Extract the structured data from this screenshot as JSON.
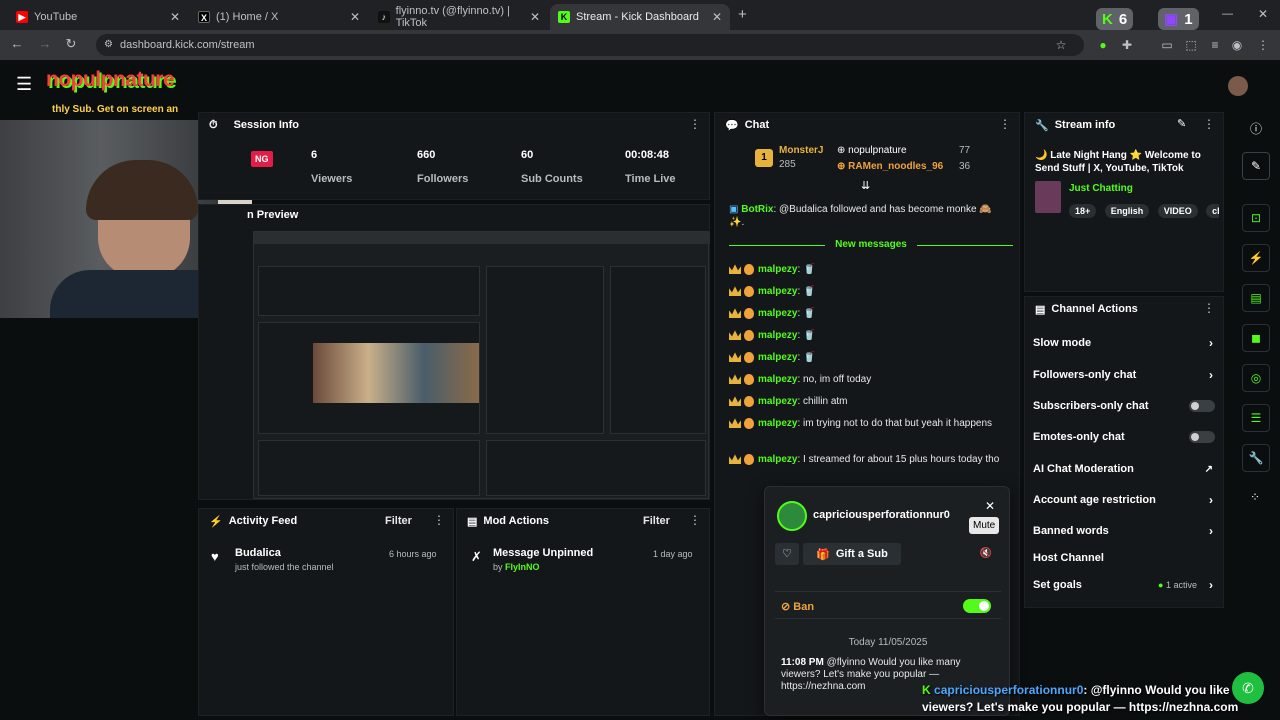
{
  "browser": {
    "tabs": [
      {
        "title": "YouTube",
        "color": "#ff0000",
        "glyph": "▶"
      },
      {
        "title": "(1) Home / X",
        "color": "#000000",
        "glyph": "X"
      },
      {
        "title": "flyinno.tv (@flyinno.tv) | TikTok",
        "color": "#111111",
        "glyph": "♪"
      },
      {
        "title": "Stream - Kick Dashboard",
        "color": "#53fc18",
        "glyph": "K"
      }
    ],
    "url": "dashboard.kick.com/stream",
    "ext_kick_count": "6",
    "ext_twitch_count": "1"
  },
  "header": {
    "logo_text": "nopulpnature",
    "overlay_line": "thly Sub. Get on screen an"
  },
  "session": {
    "title": "Session Info",
    "live_badge": "NG",
    "stats": [
      {
        "value": "6",
        "label": "Viewers"
      },
      {
        "value": "660",
        "label": "Followers"
      },
      {
        "value": "60",
        "label": "Sub Counts"
      },
      {
        "value": "00:08:48",
        "label": "Time Live"
      }
    ],
    "preview_title": "n Preview"
  },
  "chat": {
    "title": "Chat",
    "leaderboard": {
      "rank": "1",
      "top_name": "MonsterJ",
      "top_count": "285",
      "others": [
        {
          "name": "nopulpnature",
          "count": "77"
        },
        {
          "name": "RAMen_noodles_96",
          "count": "36"
        }
      ]
    },
    "botrix_user": "BotRix",
    "botrix_msg": ": @Budalica followed and has become monke 🙈 ✨.",
    "new_messages": "New messages",
    "messages": [
      {
        "user": "malpezy",
        "text": ": 🥤"
      },
      {
        "user": "malpezy",
        "text": ": 🥤"
      },
      {
        "user": "malpezy",
        "text": ": 🥤"
      },
      {
        "user": "malpezy",
        "text": ": 🥤"
      },
      {
        "user": "malpezy",
        "text": ": 🥤"
      },
      {
        "user": "malpezy",
        "text": ": no, im off today"
      },
      {
        "user": "malpezy",
        "text": ": chillin atm"
      },
      {
        "user": "malpezy",
        "text": ": im trying not to do that but yeah it happens"
      },
      {
        "user": "malpezy",
        "text": ": I streamed for about 15 plus hours today tho"
      }
    ]
  },
  "popup": {
    "username": "capriciousperforationnur0",
    "mute_tooltip": "Mute",
    "gift_label": "Gift a Sub",
    "ban_label": "Ban",
    "date": "Today 11/05/2025",
    "time": "11:08 PM",
    "message": "@flyinno Would you like many viewers? Let's make you popular — https://nezhna.com"
  },
  "stream_info": {
    "title": "Stream info",
    "stream_title": "🌙 Late Night Hang ⭐ Welcome to Send Stuff | X, YouTube, TikTok",
    "category": "Just Chatting",
    "tags": [
      "18+",
      "English",
      "VIDEO",
      "ch"
    ]
  },
  "channel_actions": {
    "title": "Channel Actions",
    "items": [
      {
        "label": "Slow mode",
        "kind": "chevron"
      },
      {
        "label": "Followers-only chat",
        "kind": "chevron"
      },
      {
        "label": "Subscribers-only chat",
        "kind": "toggle"
      },
      {
        "label": "Emotes-only chat",
        "kind": "toggle"
      },
      {
        "label": "AI Chat Moderation",
        "kind": "link"
      },
      {
        "label": "Account age restriction",
        "kind": "chevron"
      },
      {
        "label": "Banned words",
        "kind": "chevron"
      },
      {
        "label": "Host Channel",
        "kind": "none"
      },
      {
        "label": "Set goals",
        "kind": "chevron",
        "extra": "1 active"
      }
    ]
  },
  "activity": {
    "title": "Activity Feed",
    "filter": "Filter",
    "item_user": "Budalica",
    "item_text": "just followed the channel",
    "item_time": "6 hours ago"
  },
  "mod_actions": {
    "title": "Mod Actions",
    "filter": "Filter",
    "item_action": "Message Unpinned",
    "item_by": "by",
    "item_user": "FlyInNO",
    "item_time": "1 day ago"
  },
  "overlay_chat": {
    "user": "capriciousperforationnur0",
    "text": ": @flyinno Would you like many viewers? Let's make you popular — https://nezhna.com"
  },
  "colors": {
    "kick_green": "#53fc18",
    "panel": "#141719",
    "bg": "#0b0e0f"
  }
}
